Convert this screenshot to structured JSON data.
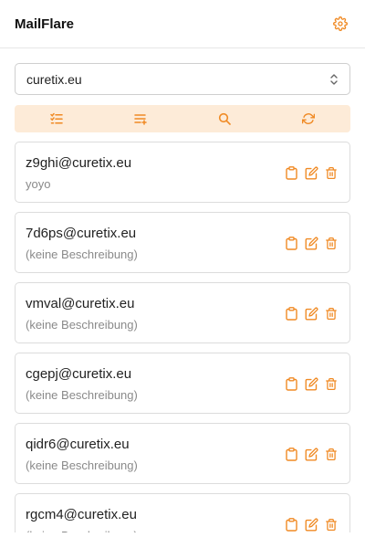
{
  "app": {
    "title": "MailFlare"
  },
  "domain_select": {
    "value": "curetix.eu"
  },
  "toolbar": {
    "buttons": [
      {
        "icon": "list-check-icon"
      },
      {
        "icon": "list-add-icon"
      },
      {
        "icon": "search-icon"
      },
      {
        "icon": "refresh-icon"
      }
    ]
  },
  "colors": {
    "accent": "#f08a24",
    "toolbar_bg": "#fdebd8"
  },
  "addresses": [
    {
      "email": "z9ghi@curetix.eu",
      "description": "yoyo"
    },
    {
      "email": "7d6ps@curetix.eu",
      "description": "(keine Beschreibung)"
    },
    {
      "email": "vmval@curetix.eu",
      "description": "(keine Beschreibung)"
    },
    {
      "email": "cgepj@curetix.eu",
      "description": "(keine Beschreibung)"
    },
    {
      "email": "qidr6@curetix.eu",
      "description": "(keine Beschreibung)"
    },
    {
      "email": "rgcm4@curetix.eu",
      "description": "(keine Beschreibung)"
    }
  ]
}
